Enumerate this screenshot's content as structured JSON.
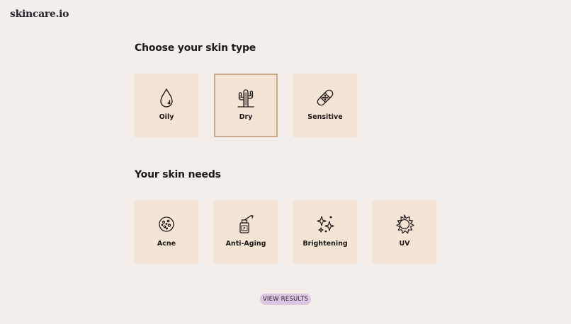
{
  "brand": {
    "logo": "skincare.io"
  },
  "skin_type": {
    "title": "Choose your skin type",
    "selected": "Dry",
    "options": [
      {
        "label": "Oily",
        "icon": "droplet-icon"
      },
      {
        "label": "Dry",
        "icon": "cactus-icon"
      },
      {
        "label": "Sensitive",
        "icon": "bandage-icon"
      }
    ]
  },
  "skin_needs": {
    "title": "Your skin needs",
    "options": [
      {
        "label": "Acne",
        "icon": "acne-icon"
      },
      {
        "label": "Anti-Aging",
        "icon": "serum-bottle-icon"
      },
      {
        "label": "Brightening",
        "icon": "sparkles-icon"
      },
      {
        "label": "UV",
        "icon": "sun-icon"
      }
    ]
  },
  "actions": {
    "view_results": "VIEW RESULTS"
  },
  "colors": {
    "background": "#f3eeea",
    "tile": "#f3e4d6",
    "selected_border": "#c9ab8c",
    "button": "#dcc7e2"
  }
}
